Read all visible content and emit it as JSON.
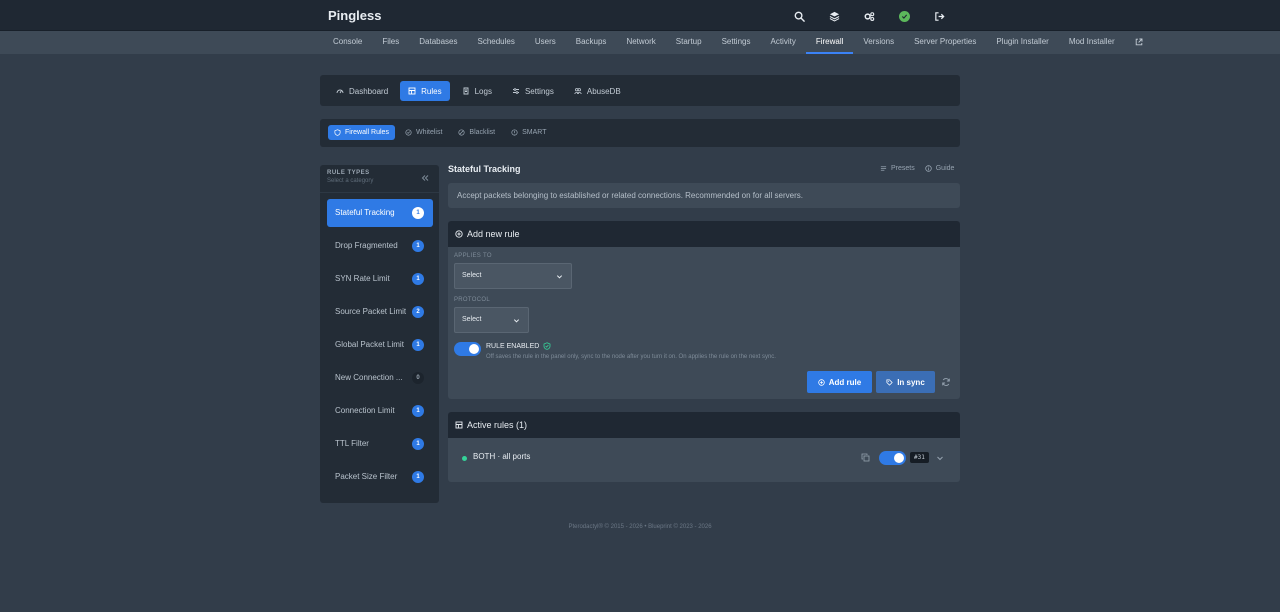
{
  "app": {
    "title": "Pingless"
  },
  "topbar_icons": [
    "search-icon",
    "layers-icon",
    "cogs-icon",
    "avatar",
    "logout-icon"
  ],
  "nav": {
    "tabs": [
      "Console",
      "Files",
      "Databases",
      "Schedules",
      "Users",
      "Backups",
      "Network",
      "Startup",
      "Settings",
      "Activity",
      "Firewall",
      "Versions",
      "Server Properties",
      "Plugin Installer",
      "Mod Installer"
    ],
    "active": "Firewall"
  },
  "subtabs": {
    "items": [
      "Dashboard",
      "Rules",
      "Logs",
      "Settings",
      "AbuseDB"
    ],
    "active": "Rules"
  },
  "fwtabs": {
    "items": [
      "Firewall Rules",
      "Whitelist",
      "Blacklist",
      "SMART"
    ],
    "active": "Firewall Rules"
  },
  "sidebar": {
    "title": "RULE TYPES",
    "subtitle": "Select a category",
    "items": [
      {
        "label": "Stateful Tracking",
        "count": "1"
      },
      {
        "label": "Drop Fragmented",
        "count": "1"
      },
      {
        "label": "SYN Rate Limit",
        "count": "1"
      },
      {
        "label": "Source Packet Limit",
        "count": "2"
      },
      {
        "label": "Global Packet Limit",
        "count": "1"
      },
      {
        "label": "New Connection ...",
        "count": "0"
      },
      {
        "label": "Connection Limit",
        "count": "1"
      },
      {
        "label": "TTL Filter",
        "count": "1"
      },
      {
        "label": "Packet Size Filter",
        "count": "1"
      }
    ]
  },
  "main": {
    "title": "Stateful Tracking",
    "presets_label": "Presets",
    "guide_label": "Guide",
    "description": "Accept packets belonging to established or related connections. Recommended on for all servers."
  },
  "add_rule": {
    "header": "Add new rule",
    "applies_to_label": "APPLIES TO",
    "applies_to_value": "Select",
    "protocol_label": "PROTOCOL",
    "protocol_value": "Select",
    "enabled_label": "RULE ENABLED",
    "enabled_help": "Off saves the rule in the panel only, sync to the node after you turn it on. On applies the rule on the next sync.",
    "enabled": true,
    "add_button": "Add rule",
    "sync_button": "In sync"
  },
  "active_rules": {
    "header": "Active rules (1)",
    "rules": [
      {
        "name": "BOTH · all ports",
        "id": "#31",
        "enabled": true,
        "status_color": "#34d399"
      }
    ]
  },
  "footer": {
    "text": "Pterodactyl® © 2015 - 2026  •  Blueprint © 2023 - 2026"
  },
  "colors": {
    "accent": "#2f7ae5",
    "background": "#323d4a",
    "panel": "#232c36"
  }
}
